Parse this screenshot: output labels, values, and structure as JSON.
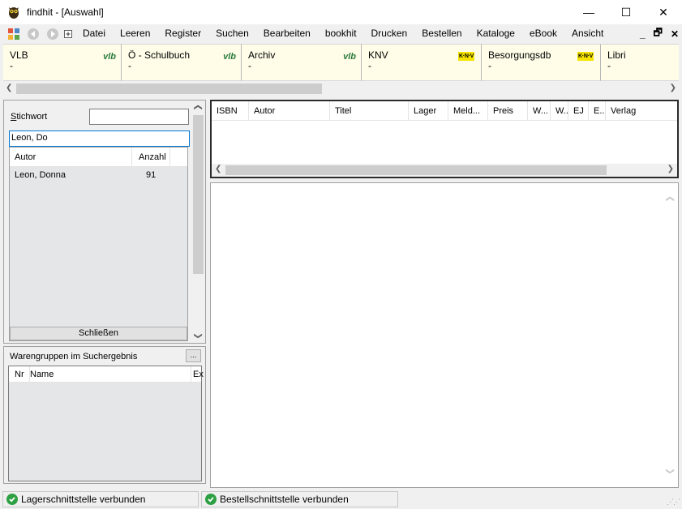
{
  "window": {
    "title": "findhit - [Auswahl]",
    "minimize": "—",
    "maximize": "☐",
    "close": "✕"
  },
  "menu": {
    "items": [
      "Datei",
      "Leeren",
      "Register",
      "Suchen",
      "Bearbeiten",
      "bookhit",
      "Drucken",
      "Bestellen",
      "Kataloge",
      "eBook",
      "Ansicht"
    ],
    "mdi_minimize": "_",
    "mdi_restore": "🗗",
    "mdi_close": "✕"
  },
  "catalogs": [
    {
      "name": "VLB",
      "sub": "-",
      "logo": "vlb"
    },
    {
      "name": "Ö - Schulbuch",
      "sub": "-",
      "logo": "vlb"
    },
    {
      "name": "Archiv",
      "sub": "-",
      "logo": "vlb"
    },
    {
      "name": "KNV",
      "sub": "-",
      "logo": "K·N·V"
    },
    {
      "name": "Besorgungsdb",
      "sub": "-",
      "logo": "K·N·V"
    },
    {
      "name": "Libri",
      "sub": "-",
      "logo": ""
    }
  ],
  "search": {
    "label_prefix": "S",
    "label_rest": "tichwort",
    "stichwort_value": "",
    "query_value": "Leon, Do"
  },
  "dropdown": {
    "col_author": "Autor",
    "col_count": "Anzahl",
    "rows": [
      {
        "author": "Leon, Donna",
        "count": "91"
      }
    ],
    "close_label": "Schließen"
  },
  "warengruppen": {
    "title": "Warengruppen im Suchergebnis",
    "button": "...",
    "col_nr": "Nr",
    "col_name": "Name",
    "col_ex": "Ex"
  },
  "results_grid": {
    "columns": [
      "ISBN",
      "Autor",
      "Titel",
      "Lager",
      "Meld...",
      "Preis",
      "W...",
      "W...",
      "EJ",
      "E...",
      "Verlag"
    ]
  },
  "status": {
    "lager": "Lagerschnittstelle verbunden",
    "bestell": "Bestellschnittstelle verbunden"
  }
}
